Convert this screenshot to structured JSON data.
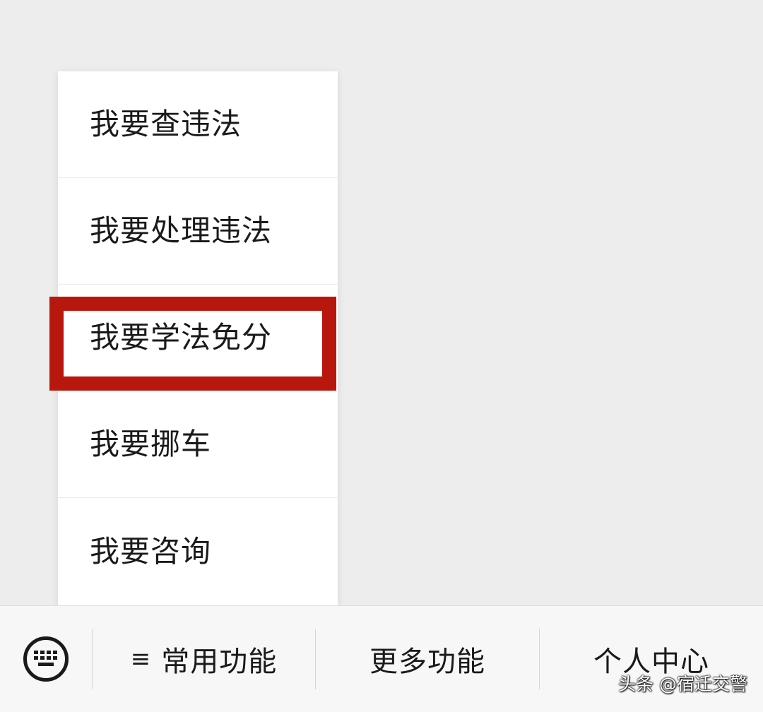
{
  "menu": {
    "items": [
      {
        "label": "我要查违法"
      },
      {
        "label": "我要处理违法"
      },
      {
        "label": "我要学法免分"
      },
      {
        "label": "我要挪车"
      },
      {
        "label": "我要咨询"
      }
    ],
    "highlighted_item": "我要学法免分",
    "highlight_color": "#b8170e"
  },
  "bottom_bar": {
    "keyboard_icon": "keyboard-icon",
    "menu_icon_glyph": "≡",
    "tabs": [
      {
        "label": "常用功能",
        "icon": "menu-lines-icon"
      },
      {
        "label": "更多功能"
      },
      {
        "label": "个人中心"
      }
    ]
  },
  "watermark": "头条 @宿迁交警"
}
